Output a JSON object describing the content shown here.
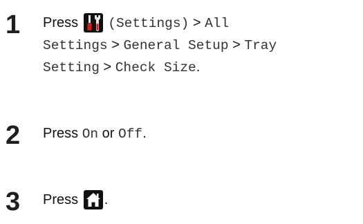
{
  "colors": {
    "settings_icon_bg": "#111111",
    "home_icon_bg": "#111111",
    "wrench_handle": "#d41c1c"
  },
  "steps": [
    {
      "number": "1",
      "press": "Press",
      "icon": "settings-icon",
      "settings_label": "(Settings)",
      "sep1": ">",
      "path1": "All",
      "path2": "Settings",
      "sep2": ">",
      "path3": "General Setup",
      "sep3": ">",
      "path4": "Tray",
      "path5": "Setting",
      "sep4": ">",
      "path6": "Check Size",
      "end": "."
    },
    {
      "number": "2",
      "press": "Press",
      "opt1": "On",
      "or": "or",
      "opt2": "Off",
      "end": "."
    },
    {
      "number": "3",
      "press": "Press",
      "icon": "home-icon",
      "end": "."
    }
  ]
}
